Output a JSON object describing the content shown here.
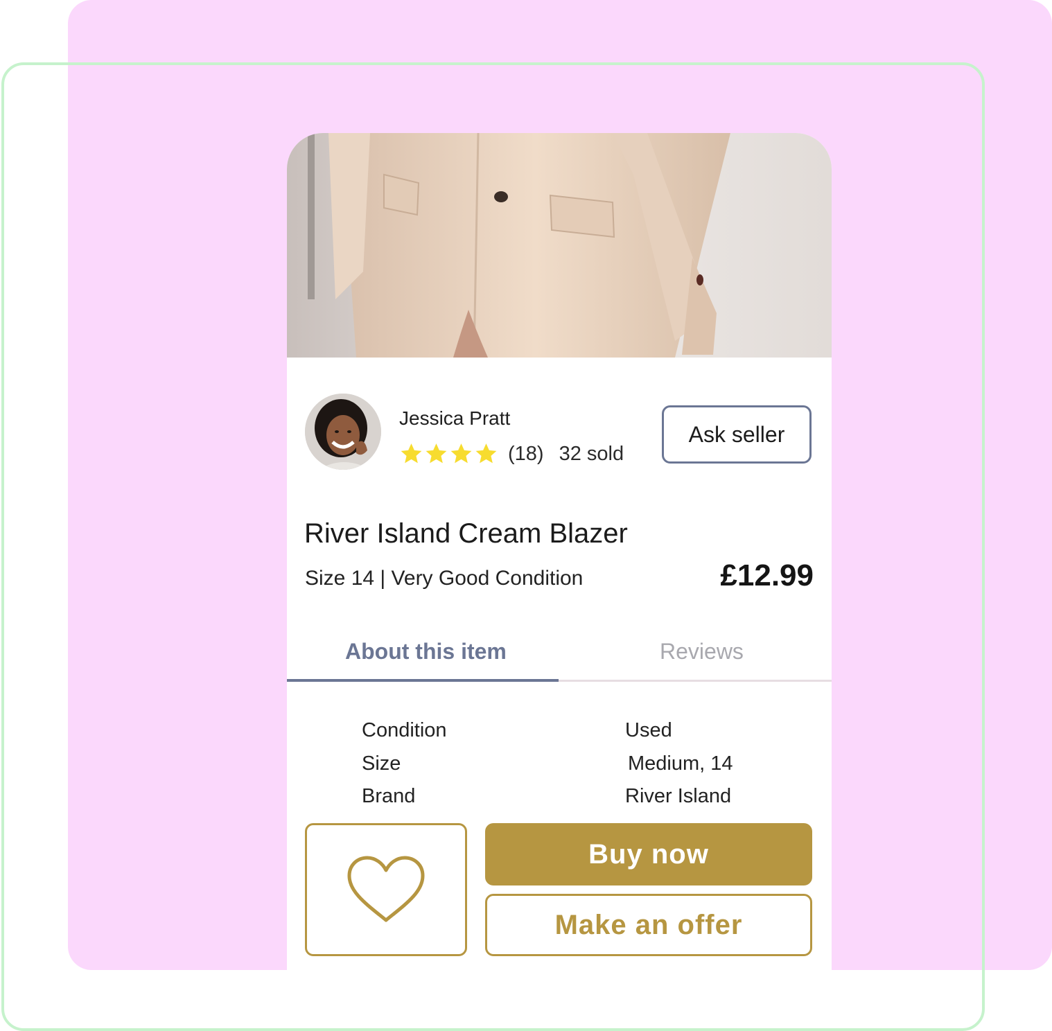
{
  "product": {
    "image_alt": "cream blazer photo",
    "title": "River Island Cream Blazer",
    "subtitle": "Size 14 | Very Good Condition",
    "price": "£12.99"
  },
  "seller": {
    "name": "Jessica Pratt",
    "rating_stars": 4,
    "review_count": "(18)",
    "sold": "32 sold",
    "ask_label": "Ask seller"
  },
  "tabs": [
    {
      "label": "About this item",
      "active": true
    },
    {
      "label": "Reviews",
      "active": false
    }
  ],
  "details": [
    {
      "label": "Condition",
      "value": "Used"
    },
    {
      "label": "Size",
      "value": "Medium, 14"
    },
    {
      "label": "Brand",
      "value": "River Island"
    }
  ],
  "actions": {
    "favourite_icon": "heart-icon",
    "buy_label": "Buy now",
    "offer_label": "Make an offer"
  },
  "colors": {
    "accent_gold": "#b69641",
    "tab_active": "#6b7694",
    "star_yellow": "#f7dc2f",
    "background_pink": "#fbd8fc",
    "frame_green": "#c6f2cc"
  }
}
